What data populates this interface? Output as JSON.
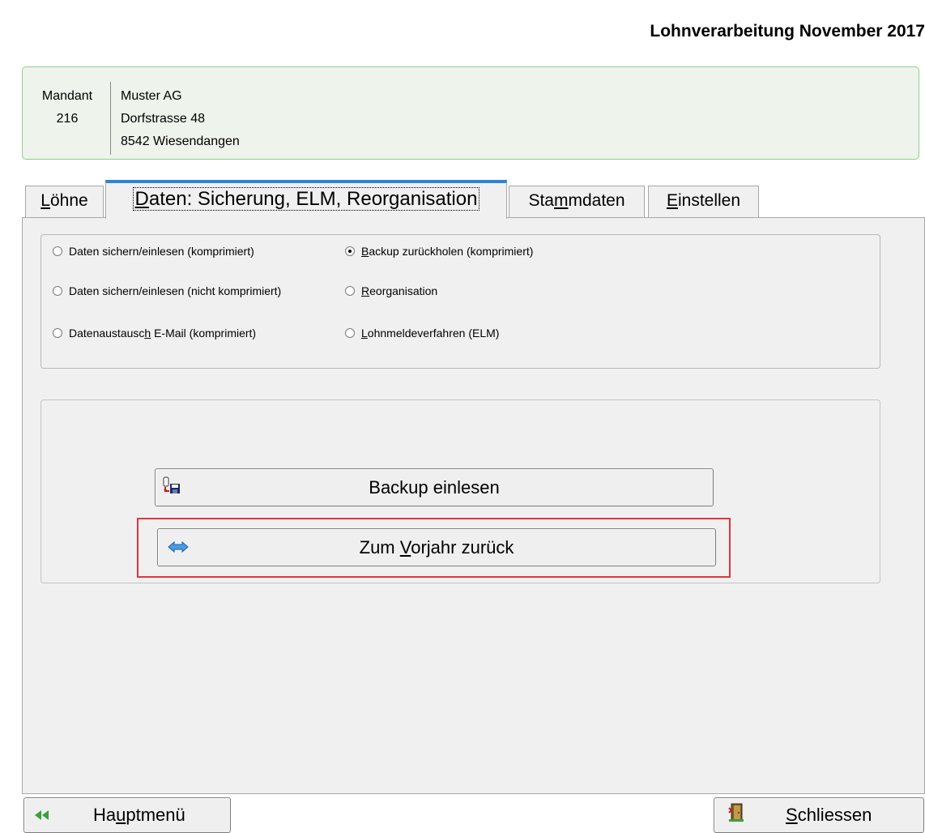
{
  "title": "Lohnverarbeitung November 2017",
  "client": {
    "label": "Mandant",
    "number": "216",
    "name": "Muster AG",
    "street": "Dorfstrasse 48",
    "city": "8542 Wiesendangen"
  },
  "tabs": [
    {
      "pre": "",
      "u": "L",
      "post": "öhne",
      "active": false
    },
    {
      "pre": "",
      "u": "D",
      "post": "aten: Sicherung, ELM, Reorganisation",
      "active": true
    },
    {
      "pre": "Sta",
      "u": "m",
      "post": "mdaten",
      "active": false
    },
    {
      "pre": "",
      "u": "E",
      "post": "instellen",
      "active": false
    }
  ],
  "options": [
    {
      "pre": "Daten sichern/einlesen (komprimiert)",
      "u": "",
      "post": "",
      "checked": false
    },
    {
      "pre": "Daten sichern/einlesen (nicht komprimiert)",
      "u": "",
      "post": "",
      "checked": false
    },
    {
      "pre": "Datenaustausc",
      "u": "h",
      "post": " E-Mail (komprimiert)",
      "checked": false
    },
    {
      "pre": "",
      "u": "B",
      "post": "ackup zurückholen (komprimiert)",
      "checked": true
    },
    {
      "pre": "",
      "u": "R",
      "post": "eorganisation",
      "checked": false
    },
    {
      "pre": "",
      "u": "L",
      "post": "ohnmeldeverfahren (ELM)",
      "checked": false
    }
  ],
  "actions": {
    "backup": {
      "pre": "Backup einlesen",
      "u": "",
      "post": ""
    },
    "vorjahr": {
      "pre": "Zum ",
      "u": "V",
      "post": "orjahr zurück"
    }
  },
  "footer": {
    "main_menu": {
      "pre": "Ha",
      "u": "u",
      "post": "ptmenü"
    },
    "close": {
      "pre": "",
      "u": "S",
      "post": "chliessen"
    }
  },
  "colors": {
    "accent_tab": "#2f84d6",
    "highlight": "#e0353b",
    "client_border": "#8fcf8a"
  }
}
